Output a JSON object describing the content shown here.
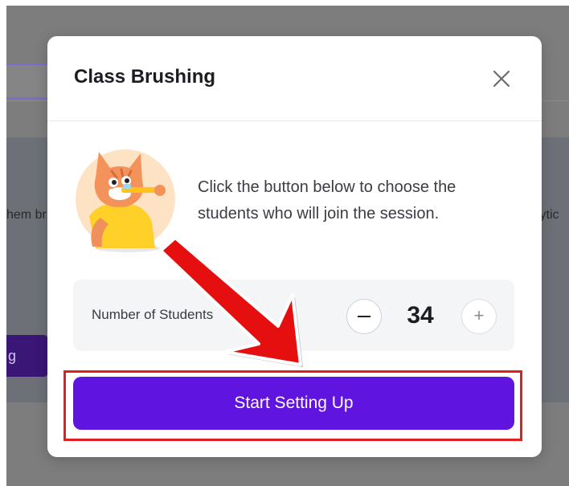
{
  "background": {
    "left_text": "hem br",
    "right_text": "lytic",
    "button_fragment": "g"
  },
  "modal": {
    "title": "Class Brushing",
    "description": "Click the button below to choose the students who will join the session.",
    "counter": {
      "label": "Number of Students",
      "value": "34",
      "plus_symbol": "+"
    },
    "primary_button": "Start Setting Up"
  },
  "colors": {
    "accent": "#6014e0",
    "annotation_red": "#e21e1e",
    "overlay": "#7d7d7d"
  },
  "icons": [
    "close-icon",
    "minus-icon",
    "plus-icon",
    "mascot-illustration",
    "annotation-arrow"
  ]
}
